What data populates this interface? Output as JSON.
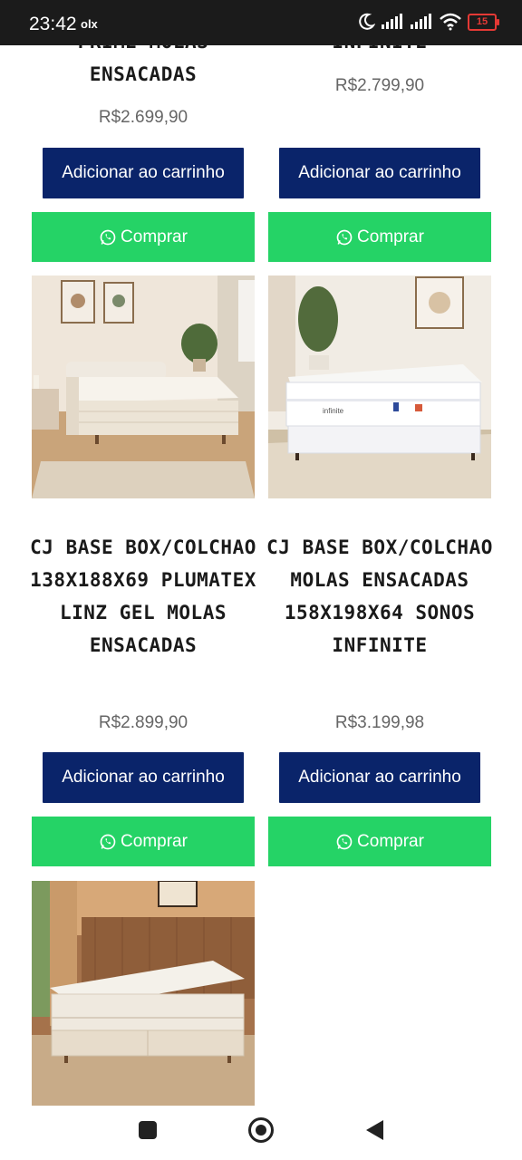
{
  "status_bar": {
    "time": "23:42",
    "app_badge": "olx",
    "battery": "15"
  },
  "products": [
    {
      "title": "PRIME MOLAS ENSACADAS",
      "price": "R$2.699,90",
      "cart_label": "Adicionar ao carrinho",
      "buy_label": "Comprar"
    },
    {
      "title": "INFINITE",
      "price": "R$2.799,90",
      "cart_label": "Adicionar ao carrinho",
      "buy_label": "Comprar"
    },
    {
      "title": "CJ BASE BOX/COLCHAO 138X188X69 PLUMATEX LINZ GEL MOLAS ENSACADAS",
      "price": "R$2.899,90",
      "cart_label": "Adicionar ao carrinho",
      "buy_label": "Comprar"
    },
    {
      "title": "CJ BASE BOX/COLCHAO MOLAS ENSACADAS 158X198X64 SONOS INFINITE",
      "price": "R$3.199,98",
      "cart_label": "Adicionar ao carrinho",
      "buy_label": "Comprar"
    },
    {
      "title": "",
      "price": "",
      "cart_label": "",
      "buy_label": ""
    }
  ],
  "colors": {
    "cart_button": "#0a246a",
    "buy_button": "#25d366",
    "price_text": "#666666"
  }
}
